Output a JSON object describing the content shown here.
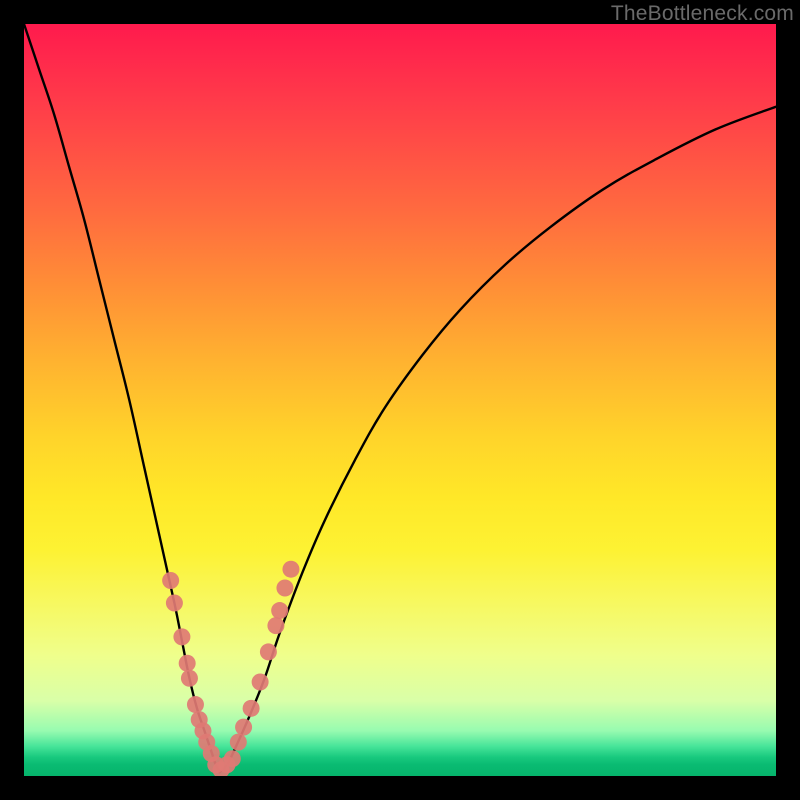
{
  "watermark": "TheBottleneck.com",
  "colors": {
    "frame": "#000000",
    "curve": "#000000",
    "marker_fill": "#e07a74",
    "marker_stroke": "#c45a55"
  },
  "chart_data": {
    "type": "line",
    "title": "",
    "xlabel": "",
    "ylabel": "",
    "xlim": [
      0,
      100
    ],
    "ylim": [
      0,
      100
    ],
    "grid": false,
    "legend": false,
    "series": [
      {
        "name": "left-branch-bottleneck-curve",
        "x": [
          0,
          2,
          4,
          6,
          8,
          10,
          12,
          14,
          16,
          18,
          20,
          21,
          22,
          23,
          24,
          25,
          25.5,
          26
        ],
        "y": [
          100,
          94,
          88,
          81,
          74,
          66,
          58,
          50,
          41,
          32,
          23,
          18,
          13,
          9,
          6,
          3,
          1.5,
          0.5
        ]
      },
      {
        "name": "right-branch-bottleneck-curve",
        "x": [
          26,
          27,
          28,
          30,
          32,
          34,
          37,
          40,
          44,
          48,
          53,
          58,
          64,
          70,
          77,
          84,
          92,
          100
        ],
        "y": [
          0.5,
          1.5,
          3.5,
          8,
          13,
          19,
          27,
          34,
          42,
          49,
          56,
          62,
          68,
          73,
          78,
          82,
          86,
          89
        ]
      }
    ],
    "markers": [
      {
        "series": "left",
        "x": 19.5,
        "y": 26
      },
      {
        "series": "left",
        "x": 20.0,
        "y": 23
      },
      {
        "series": "left",
        "x": 21.0,
        "y": 18.5
      },
      {
        "series": "left",
        "x": 21.7,
        "y": 15
      },
      {
        "series": "left",
        "x": 22.0,
        "y": 13
      },
      {
        "series": "left",
        "x": 22.8,
        "y": 9.5
      },
      {
        "series": "left",
        "x": 23.3,
        "y": 7.5
      },
      {
        "series": "left",
        "x": 23.8,
        "y": 6
      },
      {
        "series": "left",
        "x": 24.3,
        "y": 4.5
      },
      {
        "series": "left",
        "x": 24.9,
        "y": 3
      },
      {
        "series": "valley",
        "x": 25.5,
        "y": 1.5
      },
      {
        "series": "valley",
        "x": 26.2,
        "y": 0.8
      },
      {
        "series": "valley",
        "x": 27.0,
        "y": 1.5
      },
      {
        "series": "right",
        "x": 27.7,
        "y": 2.3
      },
      {
        "series": "right",
        "x": 28.5,
        "y": 4.5
      },
      {
        "series": "right",
        "x": 29.2,
        "y": 6.5
      },
      {
        "series": "right",
        "x": 30.2,
        "y": 9
      },
      {
        "series": "right",
        "x": 31.4,
        "y": 12.5
      },
      {
        "series": "right",
        "x": 32.5,
        "y": 16.5
      },
      {
        "series": "right",
        "x": 33.5,
        "y": 20
      },
      {
        "series": "right",
        "x": 34.0,
        "y": 22
      },
      {
        "series": "right",
        "x": 34.7,
        "y": 25
      },
      {
        "series": "right",
        "x": 35.5,
        "y": 27.5
      }
    ]
  }
}
